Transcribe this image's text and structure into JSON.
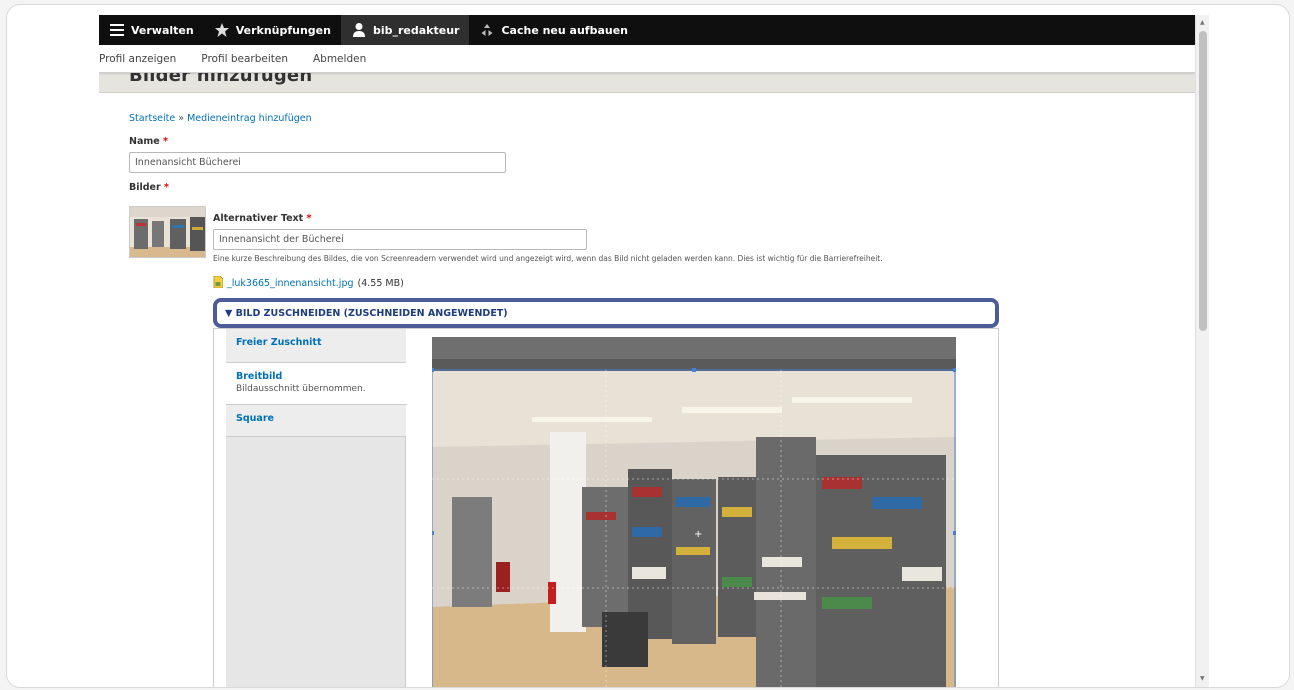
{
  "toolbar": {
    "items": [
      {
        "label": "Verwalten",
        "icon": "menu-icon"
      },
      {
        "label": "Verknüpfungen",
        "icon": "star-icon"
      },
      {
        "label": "bib_redakteur",
        "icon": "user-icon"
      },
      {
        "label": "Cache neu aufbauen",
        "icon": "recycle-icon"
      }
    ]
  },
  "tray": {
    "items": [
      "Profil anzeigen",
      "Profil bearbeiten",
      "Abmelden"
    ]
  },
  "page": {
    "title": "Bilder hinzufügen",
    "breadcrumb": [
      "Startseite",
      "Medieneintrag hinzufügen"
    ],
    "breadcrumb_sep": "»"
  },
  "form": {
    "name_label": "Name",
    "name_value": "Innenansicht Bücherei",
    "images_label": "Bilder",
    "alt_label": "Alternativer Text",
    "alt_value": "Innenansicht der Bücherei",
    "required_mark": "*",
    "alt_description": "Eine kurze Beschreibung des Bildes, die von Screenreadern verwendet wird und angezeigt wird, wenn das Bild nicht geladen werden kann. Dies ist wichtig für die Barrierefreiheit.",
    "file_name": "_luk3665_innenansicht.jpg",
    "file_size": "(4.55 MB)"
  },
  "crop": {
    "summary": "▼ BILD ZUSCHNEIDEN (ZUSCHNEIDEN ANGEWENDET)",
    "tabs": [
      {
        "title": "Freier Zuschnitt",
        "subtitle": ""
      },
      {
        "title": "Breitbild",
        "subtitle": "Bildausschnitt übernommen."
      },
      {
        "title": "Square",
        "subtitle": ""
      }
    ]
  },
  "colors": {
    "toolbar_bg": "#0f0f0f",
    "link": "#0071b8",
    "summary_border": "#4d5b96",
    "required": "#e00000"
  }
}
